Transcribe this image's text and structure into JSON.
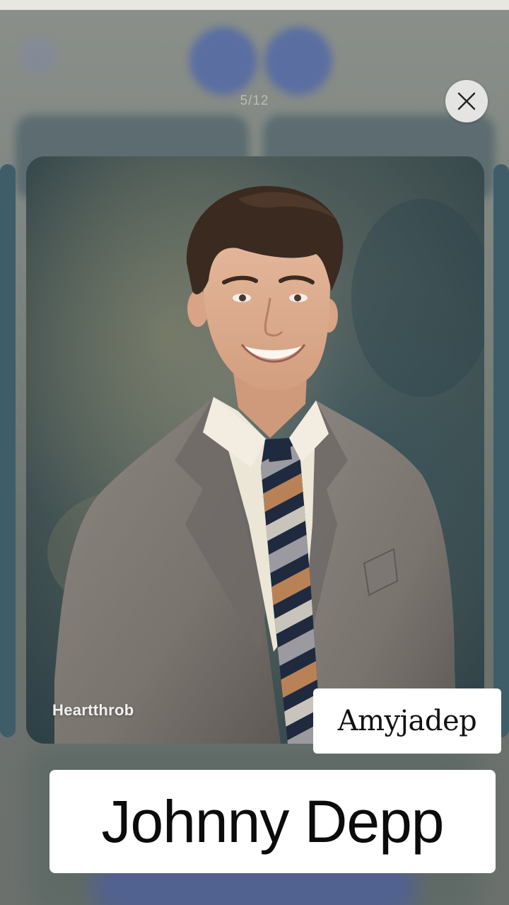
{
  "viewer": {
    "counter": "5/12",
    "close_icon": "close-icon",
    "tag_label": "Heartthrob"
  },
  "overlay": {
    "credit": "Amyjadep",
    "title": "Johnny Depp"
  },
  "colors": {
    "background": "#7d837f",
    "blurred_accent": "#4f67a8",
    "overlay_box": "#ffffff"
  }
}
